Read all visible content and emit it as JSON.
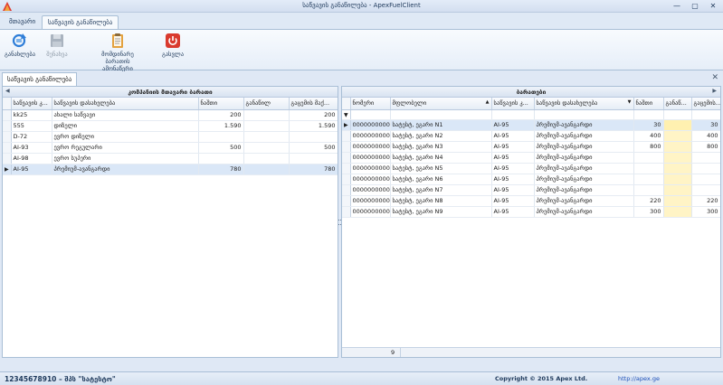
{
  "window": {
    "title": "საწვავის განაწილება - ApexFuelClient",
    "min_label": "—",
    "max_label": "▢",
    "close_label": "✕"
  },
  "ribbon_tabs": [
    "მთავარი",
    "საწვავის განაწილება"
  ],
  "ribbon_buttons": [
    {
      "label": "განახლება",
      "icon": "refresh-icon"
    },
    {
      "label": "შენახვა",
      "icon": "save-icon"
    },
    {
      "label": "მომდინარე ბარათის ამონაწერი",
      "icon": "clipboard-icon"
    },
    {
      "label": "გასვლა",
      "icon": "power-icon"
    }
  ],
  "doc_tab": {
    "label": "საწვავის განაწილება",
    "close": "✕"
  },
  "left_panel": {
    "title": "კომპანიის მთავარი ბარათი",
    "columns": [
      "საწვავის კ...",
      "საწვავის დასახელება",
      "ნაშთი",
      "განაწილ",
      "გაცემის მაქ..."
    ],
    "rows": [
      {
        "code": "kk25",
        "name": "ახალი საწვავი",
        "balance": "200",
        "dist": "",
        "max": "200"
      },
      {
        "code": "555",
        "name": "დიზელი",
        "balance": "1.590",
        "dist": "",
        "max": "1.590"
      },
      {
        "code": "D-72",
        "name": "ევრო დიზელი",
        "balance": "",
        "dist": "",
        "max": ""
      },
      {
        "code": "AI-93",
        "name": "ევრო რეგულარი",
        "balance": "500",
        "dist": "",
        "max": "500"
      },
      {
        "code": "AI-98",
        "name": "ევრო სუპერი",
        "balance": "",
        "dist": "",
        "max": ""
      },
      {
        "code": "AI-95",
        "name": "პრემიუმ-ავანგარდი",
        "balance": "780",
        "dist": "",
        "max": "780"
      }
    ],
    "selected_index": 5
  },
  "right_panel": {
    "title": "ბარათები",
    "columns": [
      "ნომერი",
      "მფლობელი",
      "საწვავის კ...",
      "საწვავის დასახელება",
      "ნაშთი",
      "განაწ...",
      "გაცემის..."
    ],
    "rows": [
      {
        "num": "000000000001",
        "owner": "სატესტ, ეგარი N1",
        "code": "AI-95",
        "name": "პრემიუმ-ავანგარდი",
        "balance": "30",
        "dist": "",
        "max": "30"
      },
      {
        "num": "000000000002",
        "owner": "სატესტ, ეგარი N2",
        "code": "AI-95",
        "name": "პრემიუმ-ავანგარდი",
        "balance": "400",
        "dist": "",
        "max": "400"
      },
      {
        "num": "000000000003",
        "owner": "სატესტ, ეგარი N3",
        "code": "AI-95",
        "name": "პრემიუმ-ავანგარდი",
        "balance": "800",
        "dist": "",
        "max": "800"
      },
      {
        "num": "000000000004",
        "owner": "სატესტ, ეგარი N4",
        "code": "AI-95",
        "name": "პრემიუმ-ავანგარდი",
        "balance": "",
        "dist": "",
        "max": ""
      },
      {
        "num": "000000000005",
        "owner": "სატესტ, ეგარი N5",
        "code": "AI-95",
        "name": "პრემიუმ-ავანგარდი",
        "balance": "",
        "dist": "",
        "max": ""
      },
      {
        "num": "000000000006",
        "owner": "სატესტ, ეგარი N6",
        "code": "AI-95",
        "name": "პრემიუმ-ავანგარდი",
        "balance": "",
        "dist": "",
        "max": ""
      },
      {
        "num": "000000000007",
        "owner": "სატესტ, ეგარი N7",
        "code": "AI-95",
        "name": "პრემიუმ-ავანგარდი",
        "balance": "",
        "dist": "",
        "max": ""
      },
      {
        "num": "000000000008",
        "owner": "სატესტ, ეგარი N8",
        "code": "AI-95",
        "name": "პრემიუმ-ავანგარდი",
        "balance": "220",
        "dist": "",
        "max": "220"
      },
      {
        "num": "000000000009",
        "owner": "სატესტ, ეგარი N9",
        "code": "AI-95",
        "name": "პრემიუმ-ავანგარდი",
        "balance": "300",
        "dist": "",
        "max": "300"
      }
    ],
    "selected_index": 0,
    "row_count": "9"
  },
  "status": {
    "left": "12345678910 – შპს \"სატესტო\"",
    "copyright": "Copyright © 2015 Apex Ltd.",
    "url": "http://apex.ge"
  },
  "colors": {
    "accent": "#1e395b",
    "selection": "#dae7f7",
    "highlight": "#fff4c6",
    "link": "#1c4fb8"
  }
}
